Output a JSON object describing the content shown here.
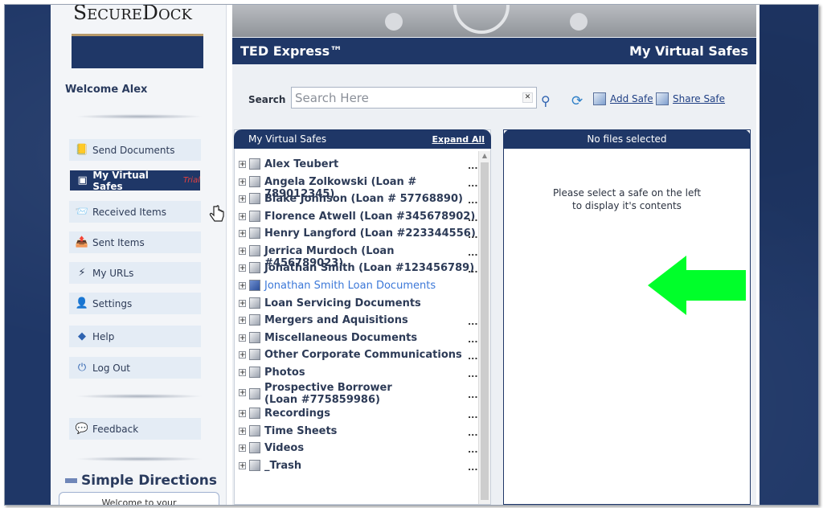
{
  "logo": "SecureDock",
  "welcome": "Welcome Alex",
  "nav": [
    {
      "label": "Send Documents",
      "icon": "send-documents-icon"
    },
    {
      "label": "My Virtual Safes",
      "icon": "safe-icon",
      "badge": "Trial"
    },
    {
      "label": "Received Items",
      "icon": "received-items-icon"
    },
    {
      "label": "Sent Items",
      "icon": "sent-items-icon"
    },
    {
      "label": "My URLs",
      "icon": "url-icon"
    },
    {
      "label": "Settings",
      "icon": "settings-icon"
    },
    {
      "label": "Help",
      "icon": "help-icon"
    },
    {
      "label": "Log Out",
      "icon": "logout-icon"
    }
  ],
  "feedback": "Feedback",
  "simple_directions": "Simple Directions",
  "welcome_box": "Welcome to your",
  "header": {
    "left": "TED Express™",
    "right": "My Virtual Safes"
  },
  "search": {
    "label": "Search",
    "placeholder": "Search Here"
  },
  "actions": {
    "add_safe": "Add Safe",
    "share_safe": "Share Safe"
  },
  "safes_panel": {
    "title": "My Virtual Safes",
    "expand_all": "Expand All",
    "items": [
      "Alex Teubert",
      "Angela Zolkowski (Loan # 789012345)",
      "Blake Johnson (Loan # 57768890)",
      "Florence Atwell (Loan #345678902)",
      "Henry Langford (Loan #223344556)",
      "Jerrica Murdoch (Loan #456789023)",
      "Jonathan Smith (Loan #123456789)",
      "Jonathan Smith Loan Documents",
      "Loan Servicing Documents",
      "Mergers and Aquisitions",
      "Miscellaneous Documents",
      "Other Corporate Communications",
      "Photos",
      "Prospective Borrower (Loan #775859986)",
      "Recordings",
      "Time Sheets",
      "Videos",
      "_Trash"
    ],
    "dots": "...",
    "selected_index": 7
  },
  "files_panel": {
    "title": "No files selected",
    "message_line1": "Please select a safe on the left",
    "message_line2": "to display it's contents"
  },
  "colors": {
    "navy": "#1f3767",
    "annotation_arrow": "#00ff2a",
    "link": "#3c78d8"
  }
}
